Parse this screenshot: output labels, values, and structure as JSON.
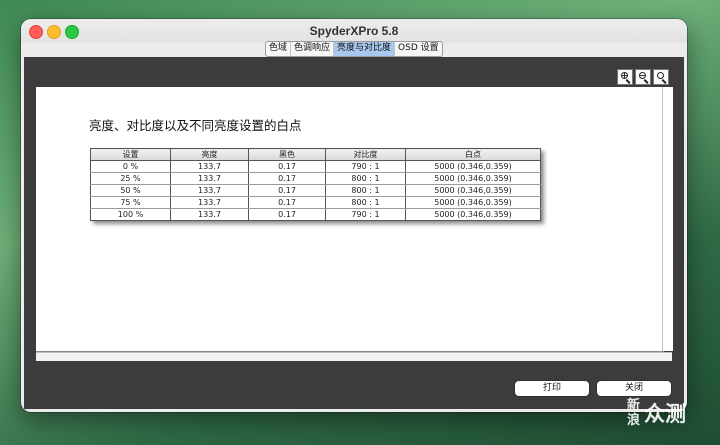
{
  "window": {
    "title": "SpyderXPro 5.8"
  },
  "tabs": [
    {
      "label": "色域",
      "active": false
    },
    {
      "label": "色调响应",
      "active": false
    },
    {
      "label": "亮度与对比度",
      "active": true
    },
    {
      "label": "OSD 设置",
      "active": false
    }
  ],
  "zoom": {
    "zoom_in_icon": "zoom-in-icon",
    "zoom_out_icon": "zoom-out-icon",
    "zoom_reset_icon": "zoom-fit-icon"
  },
  "report": {
    "title": "亮度、对比度以及不同亮度设置的白点",
    "columns": [
      "设置",
      "亮度",
      "黑色",
      "对比度",
      "白点"
    ],
    "rows": [
      [
        "0 %",
        "133.7",
        "0.17",
        "790 : 1",
        "5000 (0.346,0.359)"
      ],
      [
        "25 %",
        "133.7",
        "0.17",
        "800 : 1",
        "5000 (0.346,0.359)"
      ],
      [
        "50 %",
        "133.7",
        "0.17",
        "800 : 1",
        "5000 (0.346,0.359)"
      ],
      [
        "75 %",
        "133.7",
        "0.17",
        "800 : 1",
        "5000 (0.346,0.359)"
      ],
      [
        "100 %",
        "133.7",
        "0.17",
        "790 : 1",
        "5000 (0.346,0.359)"
      ]
    ]
  },
  "buttons": {
    "print": "打印",
    "close": "关闭"
  },
  "watermark": {
    "line1": "新",
    "line2": "浪",
    "text": "众测"
  },
  "colors": {
    "tab_active": "#a9c8ef",
    "content_bg": "#3c3c3c",
    "traffic_close": "#ff5f57",
    "traffic_min": "#febc2e",
    "traffic_max": "#28c840"
  }
}
